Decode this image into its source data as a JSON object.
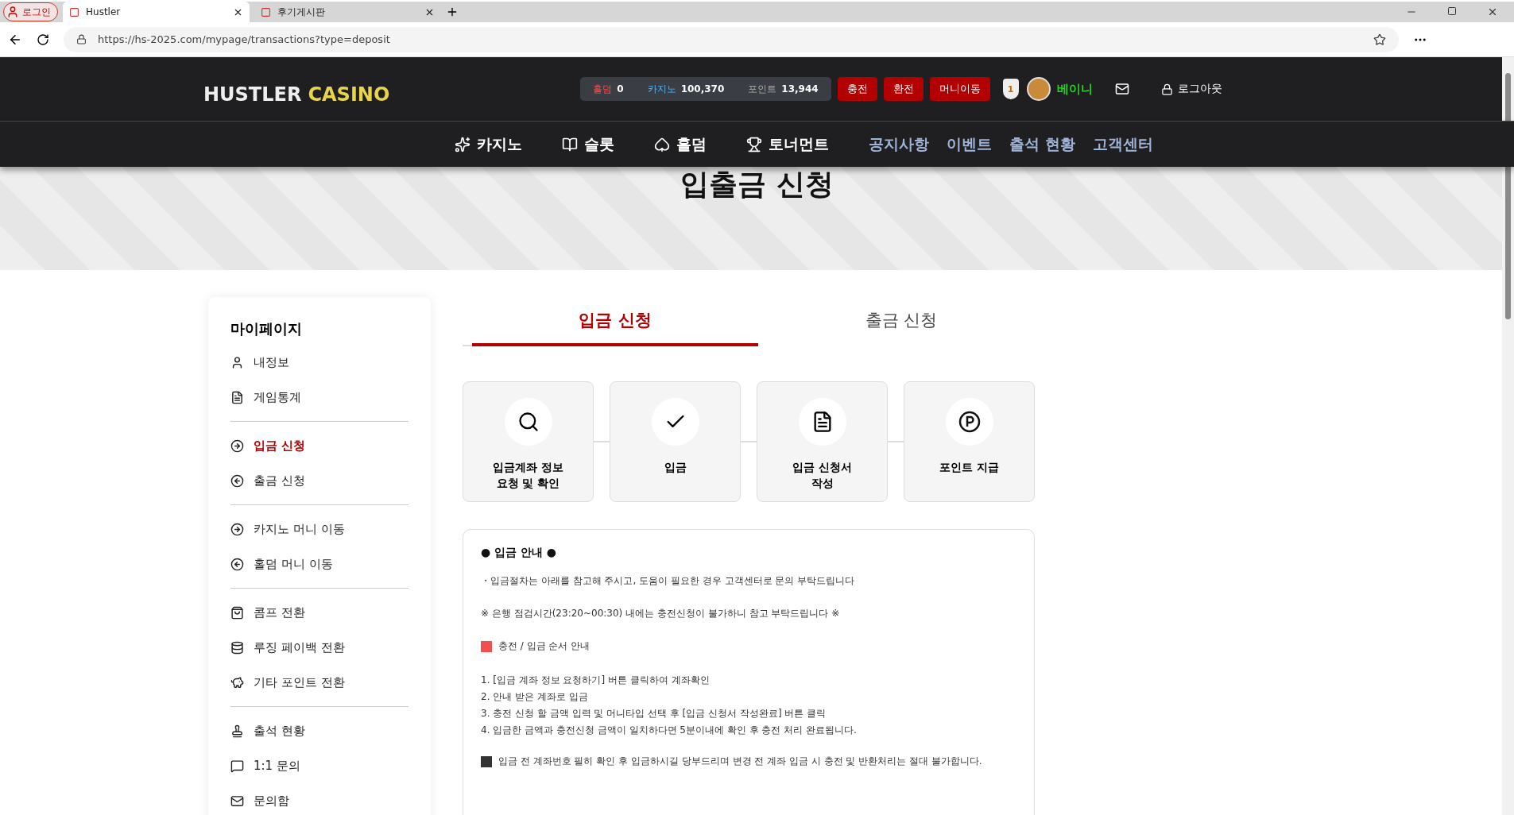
{
  "browser": {
    "profile": "로그인",
    "tabs": [
      {
        "title": "Hustler",
        "selected": true
      },
      {
        "title": "후기게시판",
        "selected": false
      }
    ],
    "url": "https://hs-2025.com/mypage/transactions?type=deposit"
  },
  "header": {
    "logo": {
      "word_1": "HUSTLER",
      "word_2": "CASINO"
    },
    "balances": [
      {
        "kind": "holdem",
        "label": "홀덤",
        "value": "0"
      },
      {
        "kind": "casino",
        "label": "카지노",
        "value": "100,370"
      },
      {
        "kind": "point",
        "label": "포인트",
        "value": "13,944"
      }
    ],
    "actions": [
      "충전",
      "환전",
      "머니이동"
    ],
    "user": {
      "level": "1",
      "name": "베이니"
    },
    "logout": "로그아웃"
  },
  "nav": [
    {
      "kind": "game",
      "label": "카지노"
    },
    {
      "kind": "game",
      "label": "슬롯"
    },
    {
      "kind": "game",
      "label": "홀덤"
    },
    {
      "kind": "game",
      "label": "토너먼트"
    },
    {
      "kind": "link",
      "label": "공지사항"
    },
    {
      "kind": "link",
      "label": "이벤트"
    },
    {
      "kind": "link",
      "label": "출석 현황"
    },
    {
      "kind": "link",
      "label": "고객센터"
    }
  ],
  "page_title": "입출금 신청",
  "sidebar": {
    "title": "마이페이지",
    "groups": [
      [
        {
          "label": "내정보",
          "selected": false
        },
        {
          "label": "게임통계",
          "selected": false
        }
      ],
      [
        {
          "label": "입금 신청",
          "selected": true
        },
        {
          "label": "출금 신청",
          "selected": false
        }
      ],
      [
        {
          "label": "카지노 머니 이동",
          "selected": false
        },
        {
          "label": "홀덤 머니 이동",
          "selected": false
        }
      ],
      [
        {
          "label": "콤프 전환",
          "selected": false
        },
        {
          "label": "루징 페이백 전환",
          "selected": false
        },
        {
          "label": "기타 포인트 전환",
          "selected": false
        }
      ],
      [
        {
          "label": "출석 현황",
          "selected": false
        },
        {
          "label": "1:1 문의",
          "selected": false
        },
        {
          "label": "문의함",
          "selected": false
        }
      ]
    ]
  },
  "tabs": [
    {
      "label": "입금 신청",
      "selected": true
    },
    {
      "label": "출금 신청",
      "selected": false
    }
  ],
  "steps": [
    {
      "lines": [
        "입금계좌 정보",
        "요청 및 확인"
      ]
    },
    {
      "lines": [
        "입금"
      ]
    },
    {
      "lines": [
        "입금 신청서",
        "작성"
      ]
    },
    {
      "lines": [
        "포인트 지급"
      ]
    }
  ],
  "notice": {
    "title": "● 입금 안내 ●",
    "blocks": [
      {
        "kind": "text",
        "text": "・입금절차는 아래를 참고해 주시고, 도움이 필요한 경우 고객센터로 문의 부탁드립니다"
      },
      {
        "kind": "text",
        "text": "※ 은행 점검시간(23:20~00:30) 내에는 충전신청이 불가하니 참고 부탁드립니다 ※"
      },
      {
        "kind": "heading",
        "text": "충전 / 입금 순서 안내"
      },
      {
        "kind": "list",
        "items": [
          "1. [입금 계좌 정보 요청하기] 버튼 클릭하여 계좌확인",
          "2. 안내 받은 계좌로 입금",
          "3. 충전 신청 할 금액 입력 및 머니타입 선택 후 [입금 신청서 작성완료] 버튼 클릭",
          "4. 입금한 금액과 충전신청 금액이 일치하다면 5분이내에 확인 후 충전 처리 완료됩니다."
        ]
      },
      {
        "kind": "warning",
        "text": "입금 전 계좌번호 필히 확인 후 입금하시길 당부드리며 변경 전 계좌 입금 시 충전 및 반환처리는 절대 불가합니다."
      }
    ]
  }
}
